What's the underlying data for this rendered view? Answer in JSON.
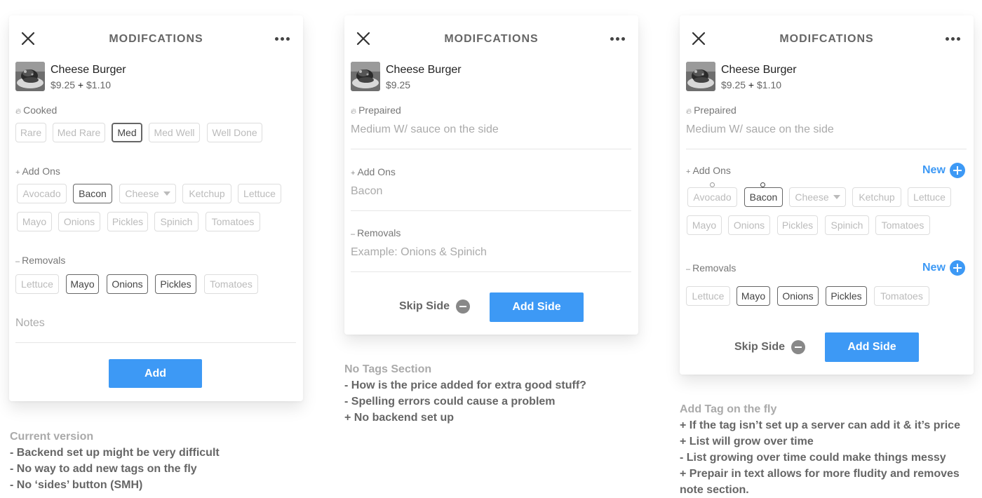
{
  "colors": {
    "accent": "#3d99f5",
    "label": "#777777",
    "chip_border": "#dddddd",
    "chip_selected_border": "#666666"
  },
  "card1": {
    "title": "MODIFCATIONS",
    "item": {
      "name": "Cheese Burger",
      "price": "$9.25",
      "plus": " + ",
      "extra": "$1.10"
    },
    "cooked": {
      "icon": "flame-icon",
      "label": "Cooked",
      "options": [
        "Rare",
        "Med Rare",
        "Med",
        "Med Well",
        "Well Done"
      ],
      "selected": "Med"
    },
    "addons": {
      "icon": "plus-icon",
      "label": "Add Ons",
      "options": [
        "Avocado",
        "Bacon",
        "Cheese",
        "Ketchup",
        "Lettuce",
        "Mayo",
        "Onions",
        "Pickles",
        "Spinich",
        "Tomatoes"
      ],
      "selected": [
        "Bacon"
      ]
    },
    "removals": {
      "icon": "minus-icon",
      "label": "Removals",
      "options": [
        "Lettuce",
        "Mayo",
        "Onions",
        "Pickles",
        "Tomatoes"
      ],
      "selected": [
        "Mayo",
        "Onions",
        "Pickles"
      ]
    },
    "notes_placeholder": "Notes",
    "add_button": "Add"
  },
  "card2": {
    "title": "MODIFCATIONS",
    "item": {
      "name": "Cheese Burger",
      "price": "$9.25"
    },
    "prepaired": {
      "label": "Prepaired",
      "value": "Medium W/ sauce on the side"
    },
    "addons": {
      "label": "Add Ons",
      "value": "Bacon"
    },
    "removals": {
      "label": "Removals",
      "placeholder": "Example: Onions & Spinich"
    },
    "skip_side": "Skip Side",
    "add_side": "Add Side"
  },
  "card3": {
    "title": "MODIFCATIONS",
    "item": {
      "name": "Cheese Burger",
      "price": "$9.25",
      "plus": " + ",
      "extra": "$1.10"
    },
    "prepaired": {
      "label": "Prepaired",
      "value": "Medium W/ sauce on the side"
    },
    "addons": {
      "label": "Add Ons",
      "new_label": "New",
      "options": [
        "Avocado",
        "Bacon",
        "Cheese",
        "Ketchup",
        "Lettuce",
        "Mayo",
        "Onions",
        "Pickles",
        "Spinich",
        "Tomatoes"
      ],
      "selected": [
        "Bacon"
      ]
    },
    "removals": {
      "label": "Removals",
      "new_label": "New",
      "options": [
        "Lettuce",
        "Mayo",
        "Onions",
        "Pickles",
        "Tomatoes"
      ],
      "selected": [
        "Mayo",
        "Onions",
        "Pickles"
      ]
    },
    "skip_side": "Skip Side",
    "add_side": "Add Side"
  },
  "notes": {
    "current": {
      "title": "Current version",
      "lines": [
        "- Backend set up might be very difficult",
        "- No way to add new tags on the fly",
        "- No ‘sides’ button (SMH)"
      ]
    },
    "no_tags": {
      "title": "No Tags Section",
      "lines": [
        "- How is the price added for extra good stuff?",
        "- Spelling errors could cause a problem",
        "+ No backend set up"
      ]
    },
    "on_the_fly": {
      "title": "Add Tag on the fly",
      "lines": [
        "+ If the tag isn’t set up a server can add it & it’s price",
        "+ List will grow over time",
        "- List growing over time could make things messy",
        "+ Prepair in text allows for more fludity and removes",
        "note section."
      ]
    }
  }
}
